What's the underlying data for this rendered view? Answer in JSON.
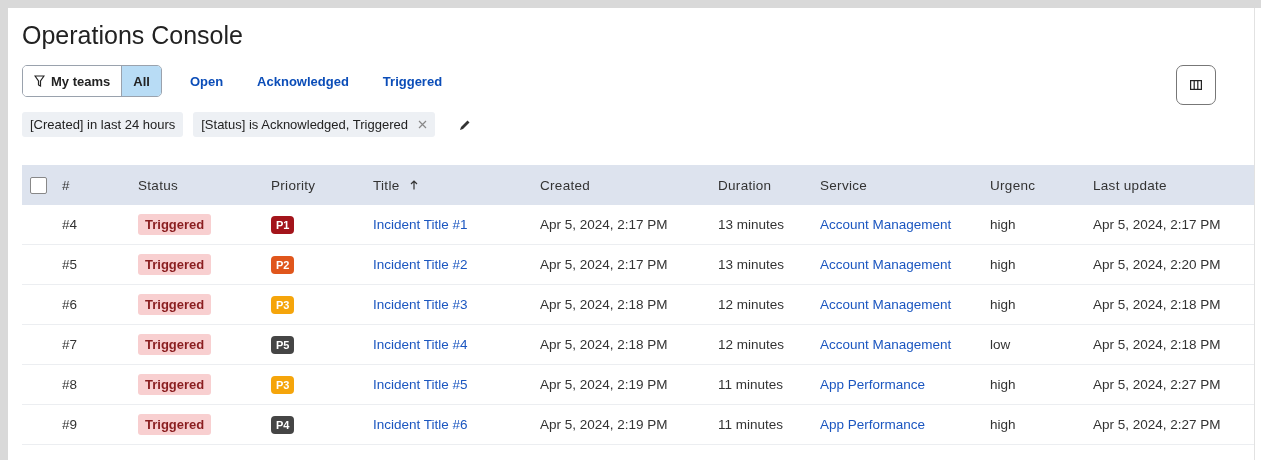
{
  "page": {
    "title": "Operations Console"
  },
  "team_toggle": [
    {
      "label": "My teams",
      "selected": false
    },
    {
      "label": "All",
      "selected": true
    }
  ],
  "quick_filters": [
    {
      "label": "Open"
    },
    {
      "label": "Acknowledged"
    },
    {
      "label": "Triggered"
    }
  ],
  "filter_chips": [
    {
      "label": "[Created] in last 24 hours",
      "removable": false
    },
    {
      "label": "[Status] is Acknowledged, Triggered",
      "removable": true
    }
  ],
  "table": {
    "columns": [
      {
        "label": "#",
        "sorted": false
      },
      {
        "label": "Status",
        "sorted": false
      },
      {
        "label": "Priority",
        "sorted": false
      },
      {
        "label": "Title",
        "sorted": true
      },
      {
        "label": "Created",
        "sorted": false
      },
      {
        "label": "Duration",
        "sorted": false
      },
      {
        "label": "Service",
        "sorted": false
      },
      {
        "label": "Urgenc",
        "sorted": false
      },
      {
        "label": "Last update",
        "sorted": false
      }
    ],
    "all_checked": false,
    "rows": [
      {
        "number": "#4",
        "status": "Triggered",
        "priority": "P1",
        "color": "#a3141b",
        "title": "Incident Title #1",
        "created": "Apr 5, 2024, 2:17 PM",
        "duration": "13 minutes",
        "service": "Account Management",
        "urgency": "high",
        "last_update": "Apr 5, 2024, 2:17 PM"
      },
      {
        "number": "#5",
        "status": "Triggered",
        "priority": "P2",
        "color": "#e0561c",
        "title": "Incident Title #2",
        "created": "Apr 5, 2024, 2:17 PM",
        "duration": "13 minutes",
        "service": "Account Management",
        "urgency": "high",
        "last_update": "Apr 5, 2024, 2:20 PM"
      },
      {
        "number": "#6",
        "status": "Triggered",
        "priority": "P3",
        "color": "#f5a50b",
        "title": "Incident Title #3",
        "created": "Apr 5, 2024, 2:18 PM",
        "duration": "12 minutes",
        "service": "Account Management",
        "urgency": "high",
        "last_update": "Apr 5, 2024, 2:18 PM"
      },
      {
        "number": "#7",
        "status": "Triggered",
        "priority": "P5",
        "color": "#454545",
        "title": "Incident Title #4",
        "created": "Apr 5, 2024, 2:18 PM",
        "duration": "12 minutes",
        "service": "Account Management",
        "urgency": "low",
        "last_update": "Apr 5, 2024, 2:18 PM"
      },
      {
        "number": "#8",
        "status": "Triggered",
        "priority": "P3",
        "color": "#f5a50b",
        "title": "Incident Title #5",
        "created": "Apr 5, 2024, 2:19 PM",
        "duration": "11 minutes",
        "service": "App Performance",
        "urgency": "high",
        "last_update": "Apr 5, 2024, 2:27 PM"
      },
      {
        "number": "#9",
        "status": "Triggered",
        "priority": "P4",
        "color": "#454545",
        "title": "Incident Title #6",
        "created": "Apr 5, 2024, 2:19 PM",
        "duration": "11 minutes",
        "service": "App Performance",
        "urgency": "high",
        "last_update": "Apr 5, 2024, 2:27 PM"
      }
    ]
  }
}
